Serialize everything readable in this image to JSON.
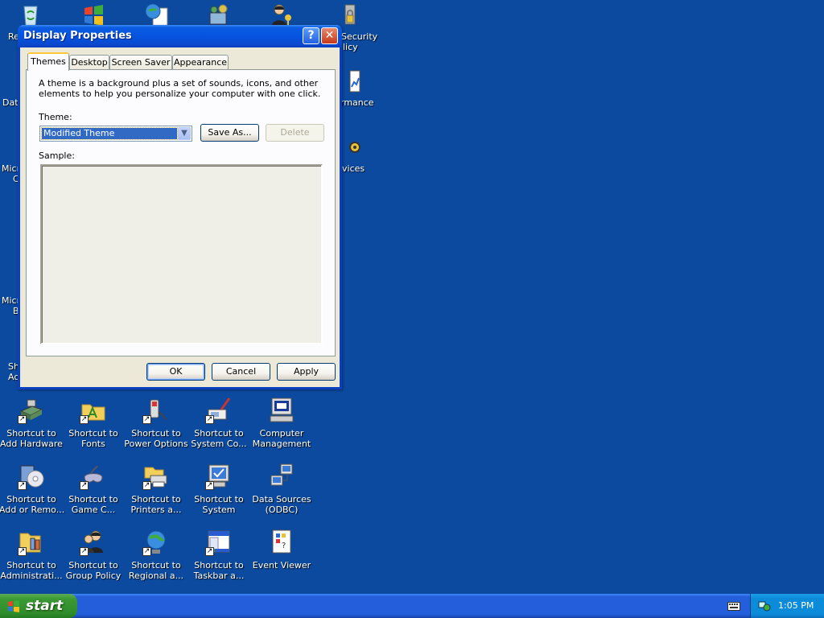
{
  "dialog": {
    "title": "Display Properties",
    "help_label": "?",
    "close_label": "✕",
    "tabs": [
      {
        "label": "Themes"
      },
      {
        "label": "Desktop"
      },
      {
        "label": "Screen Saver"
      },
      {
        "label": "Appearance"
      }
    ],
    "description": "A theme is a background plus a set of sounds, icons, and other elements to help you personalize your computer with one click.",
    "theme_label": "Theme:",
    "theme_value": "Modified Theme",
    "save_as_label": "Save As...",
    "delete_label": "Delete",
    "sample_label": "Sample:",
    "ok_label": "OK",
    "cancel_label": "Cancel",
    "apply_label": "Apply"
  },
  "desktop": {
    "partial_labels": {
      "re": "Re",
      "security": "Security",
      "licy": "licy",
      "data": "Dat",
      "rmance": "rmance",
      "micro1": "Micro",
      "micro1b": "C",
      "vices": "vices",
      "micro2": "Micro",
      "micro2b": "B",
      "sh": "Sh",
      "ac": "Ac"
    },
    "icons": [
      {
        "l1": "Shortcut to",
        "l2": "Add Hardware"
      },
      {
        "l1": "Shortcut to",
        "l2": "Fonts"
      },
      {
        "l1": "Shortcut to",
        "l2": "Power Options"
      },
      {
        "l1": "Shortcut to",
        "l2": "System Co..."
      },
      {
        "l1": "Computer",
        "l2": "Management"
      },
      {
        "l1": "Shortcut to",
        "l2": "Add or Remo..."
      },
      {
        "l1": "Shortcut to",
        "l2": "Game C..."
      },
      {
        "l1": "Shortcut to",
        "l2": "Printers a..."
      },
      {
        "l1": "Shortcut to",
        "l2": "System"
      },
      {
        "l1": "Data Sources",
        "l2": "(ODBC)"
      },
      {
        "l1": "Shortcut to",
        "l2": "Administrati..."
      },
      {
        "l1": "Shortcut to",
        "l2": "Group Policy"
      },
      {
        "l1": "Shortcut to",
        "l2": "Regional a..."
      },
      {
        "l1": "Shortcut to",
        "l2": "Taskbar a..."
      },
      {
        "l1": "Event Viewer",
        "l2": ""
      }
    ]
  },
  "taskbar": {
    "start_label": "start",
    "clock": "1:05 PM"
  }
}
